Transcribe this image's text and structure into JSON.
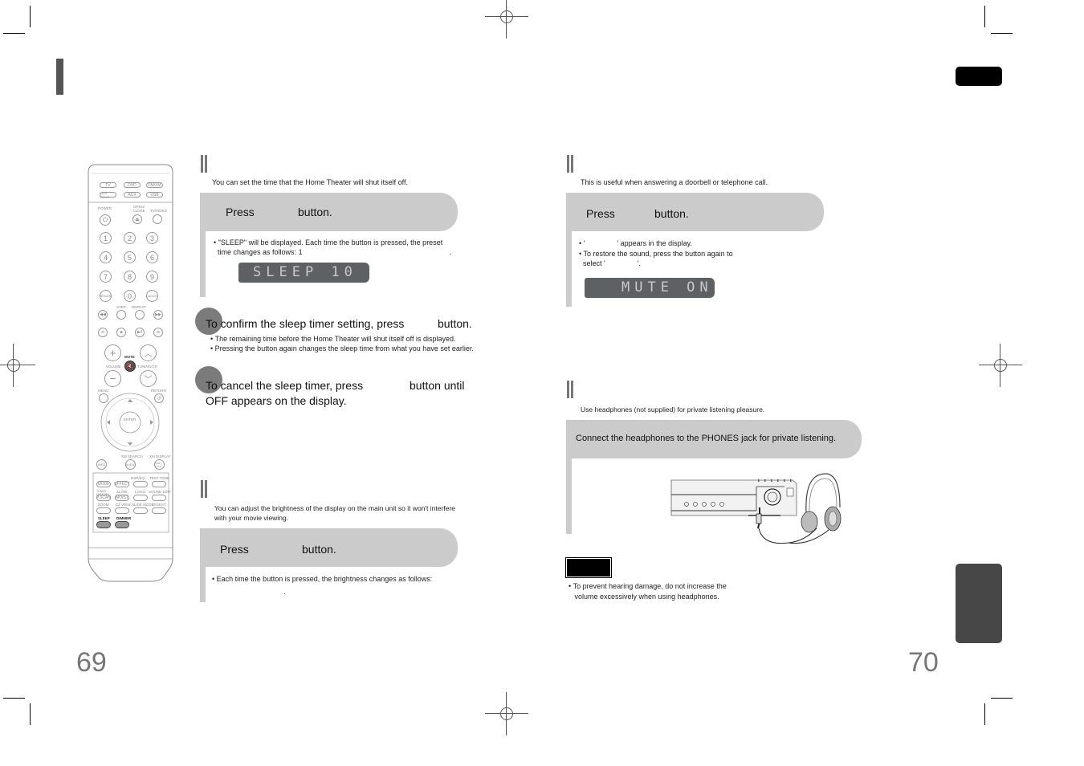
{
  "left_page": {
    "page_number": "69",
    "sleep_section": {
      "intro": "You can set the time that the Home Theater will shut itself off.",
      "step1": {
        "press": "Press",
        "button": "button."
      },
      "bullet1_line1": "\"SLEEP\" will be displayed. Each time the button is pressed, the preset",
      "bullet1_line2": "time changes as follows: 1",
      "bullet1_end": ".",
      "lcd": "SLEEP   10",
      "step2": {
        "text": "To confirm the sleep timer setting, press",
        "button": "button."
      },
      "step2_bullets": [
        "The remaining time before the Home Theater will shut itself off is displayed.",
        "Pressing the button again changes the sleep time from what you have set earlier."
      ],
      "step3": {
        "line1": "To cancel the sleep timer, press",
        "button": "button until",
        "line2": "OFF appears on the display."
      }
    },
    "dimmer_section": {
      "intro_line1": "You can adjust the brightness of the display on the main unit so it won't interfere",
      "intro_line2": "with your movie viewing.",
      "step1": {
        "press": "Press",
        "button": "button."
      },
      "bullet1": "Each time the button is pressed, the brightness changes as follows:",
      "bullet1_end": "."
    },
    "remote": {
      "source_buttons": [
        "TV",
        "DVD",
        "FM/XM",
        "DVD RCVR",
        "AUX",
        "USB"
      ],
      "power_label": "POWER",
      "open_close_label": "OPEN/ CLOSE",
      "tv_video_label": "TV/VIDEO",
      "digits": [
        "1",
        "2",
        "3",
        "4",
        "5",
        "6",
        "7",
        "8",
        "9"
      ],
      "remain": "REMAIN",
      "zero": "0",
      "cancel": "CANCEL",
      "step_label": "STEP",
      "repeat_label": "REPEAT",
      "mute_label": "MUTE",
      "volume_label": "VOLUME",
      "tuning_label": "TUNING/CH",
      "menu_label": "MENU",
      "return_label": "RETURN",
      "enter_label": "ENTER",
      "sm_search": "SM SEARCH",
      "xm_display": "XM DISPLAY",
      "info": "INFO",
      "audio": "AUDIO",
      "subtitle": "SUB TITLE",
      "dsp_eq": "DSP/EQ",
      "test_tone": "TEST TONE",
      "mode": "MODE",
      "effect": "EFFECT",
      "tuner_memory": "TUNER MEMORY",
      "slow": "SLOW",
      "logo": "LOGO",
      "sound_edit": "SOUND EDIT",
      "p_scan": "P.SCAN",
      "mo_st": "MO/ST",
      "zoom": "ZOOM",
      "ez_view": "EZ VIEW",
      "slide_mode": "SLIDE MODE",
      "digest": "DIGEST",
      "sleep": "SLEEP",
      "dimmer": "DIMMER"
    }
  },
  "right_page": {
    "page_number": "70",
    "mute_section": {
      "intro": "This is useful when answering a doorbell or telephone call.",
      "step1": {
        "press": "Press",
        "button": "button."
      },
      "bullet1": "'                ' appears in the display.",
      "bullet2_line1": "To restore the sound, press the button again to",
      "bullet2_line2": "select '                '.",
      "lcd": "MUTE  ON"
    },
    "headphones_section": {
      "intro": "Use headphones (not supplied) for private listening pleasure.",
      "step1": "Connect the headphones to the PHONES jack for private listening.",
      "note_bullet_line1": "To prevent hearing damage, do not increase the",
      "note_bullet_line2": "volume excessively when using headphones."
    }
  },
  "colors": {
    "step_box": "#cbcbcb",
    "step_circle": "#7b7b7b",
    "lcd_bg": "#5d6163",
    "side_tab": "#474747",
    "page_number": "#777777"
  }
}
